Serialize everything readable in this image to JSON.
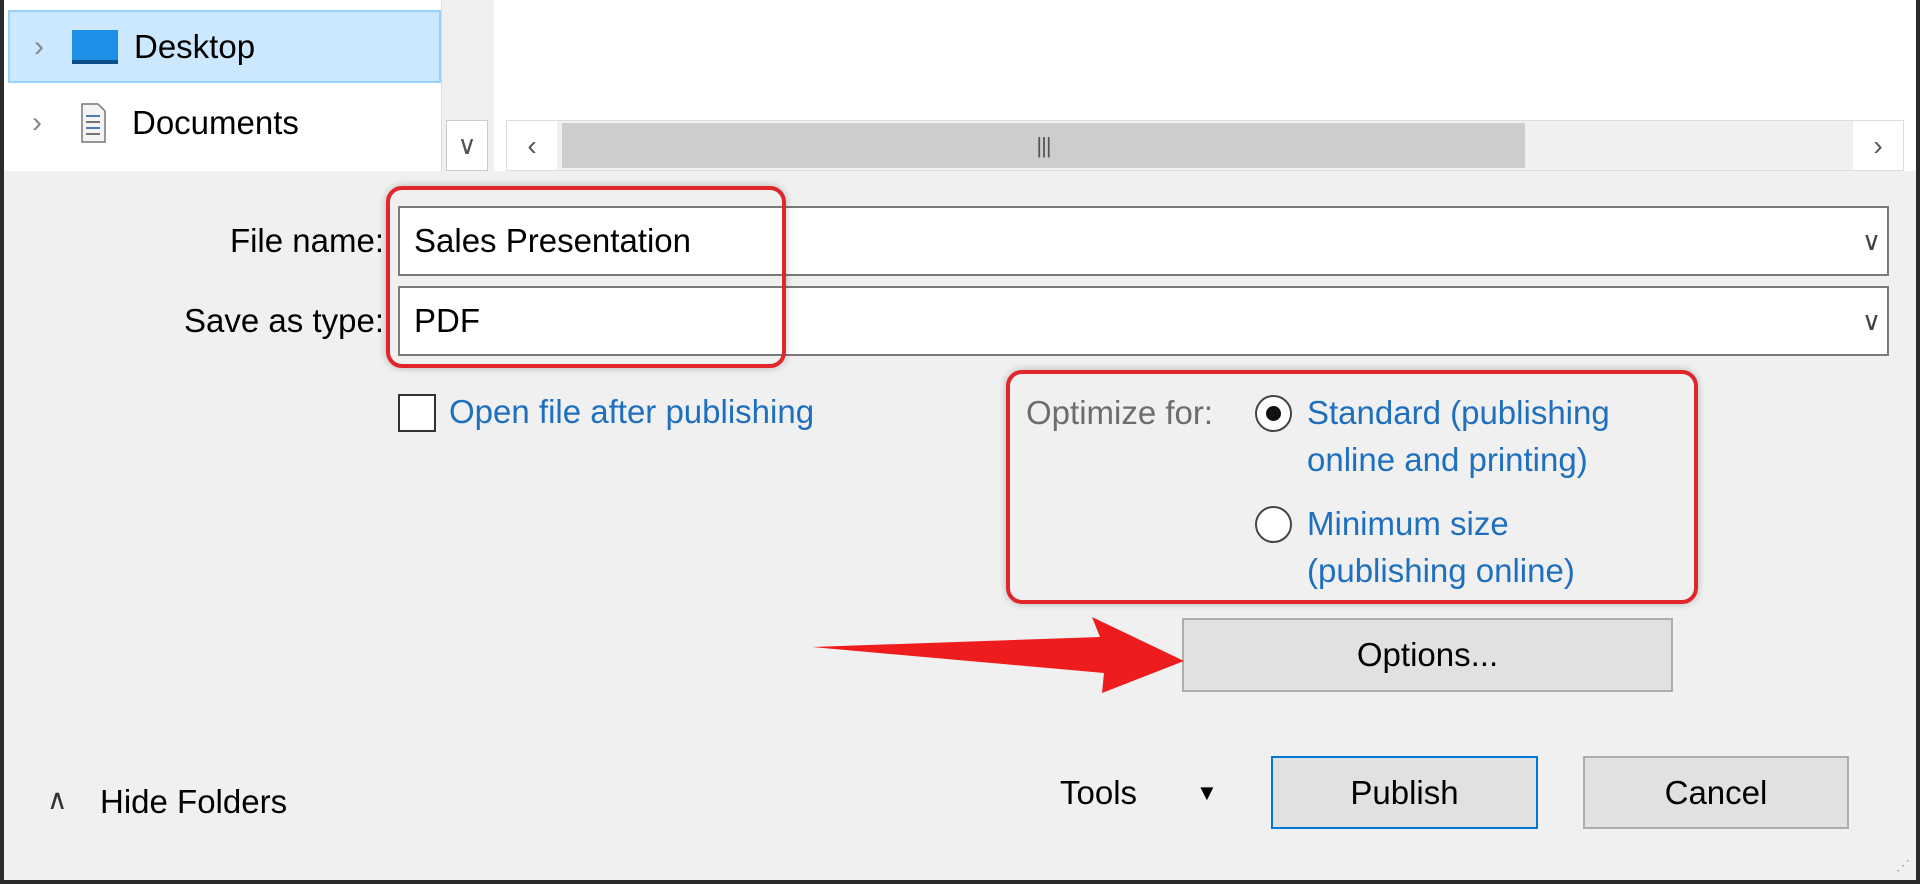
{
  "nav": {
    "items": [
      {
        "label": "Desktop",
        "icon": "desktop-icon",
        "selected": true
      },
      {
        "label": "Documents",
        "icon": "documents-icon",
        "selected": false
      }
    ]
  },
  "form": {
    "file_name_label": "File name:",
    "file_name_value": "Sales Presentation",
    "save_as_type_label": "Save as type:",
    "save_as_type_value": "PDF",
    "open_after_label": "Open file after publishing",
    "open_after_checked": false,
    "optimize_label": "Optimize for:",
    "optimize_options": [
      {
        "line1": "Standard (publishing",
        "line2": "online and printing)",
        "selected": true
      },
      {
        "line1": "Minimum size",
        "line2": "(publishing online)",
        "selected": false
      }
    ],
    "options_button": "Options..."
  },
  "footer": {
    "hide_folders": "Hide Folders",
    "tools": "Tools",
    "publish": "Publish",
    "cancel": "Cancel"
  },
  "colors": {
    "annotation_red": "#e0262b",
    "link_blue": "#1f6fbf",
    "selection": "#cce8ff"
  }
}
